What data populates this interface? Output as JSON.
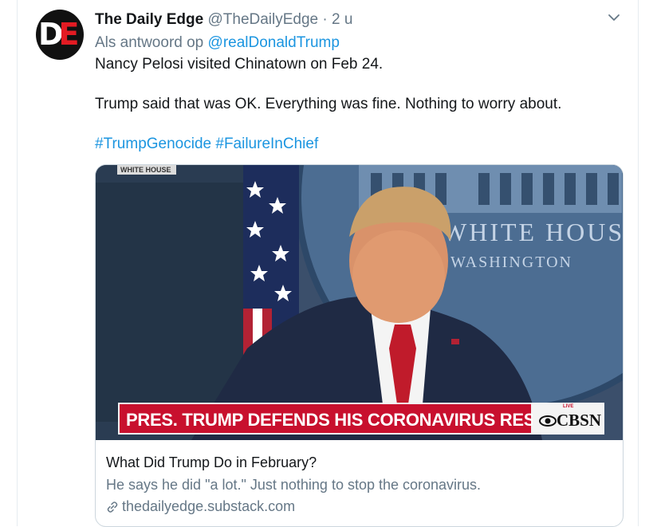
{
  "tweet": {
    "author_name": "The Daily Edge",
    "author_handle": "@TheDailyEdge",
    "separator": "·",
    "time": "2 u",
    "reply_prefix": "Als antwoord op",
    "reply_to": "@realDonaldTrump",
    "avatar_letters": {
      "d": "D",
      "e": "E"
    },
    "line1": "Nancy Pelosi visited Chinatown on Feb 24.",
    "line2": "Trump said that was OK. Everything was fine. Nothing to worry about.",
    "hashtags": [
      "#TrumpGenocide",
      "#FailureInChief"
    ],
    "more_icon": "chevron-down-icon"
  },
  "card": {
    "media": {
      "chyron_top": "WHITE HOUSE",
      "backdrop_text_1": "WHITE HOUS",
      "backdrop_text_2": "WASHINGTON",
      "lower_third": "PRES. TRUMP DEFENDS HIS CORONAVIRUS RESPONSE",
      "network_live": "LIVE",
      "network_logo": "CBSN"
    },
    "title": "What Did Trump Do in February?",
    "description": "He says he did \"a lot.\" Just nothing to stop the coronavirus.",
    "domain": "thedailyedge.substack.com",
    "link_icon": "link-icon"
  },
  "colors": {
    "link_blue": "#1b95e0",
    "secondary_text": "#657786",
    "primary_text": "#14171a",
    "border": "#ccd6dd",
    "cbs_red": "#c8102e"
  }
}
